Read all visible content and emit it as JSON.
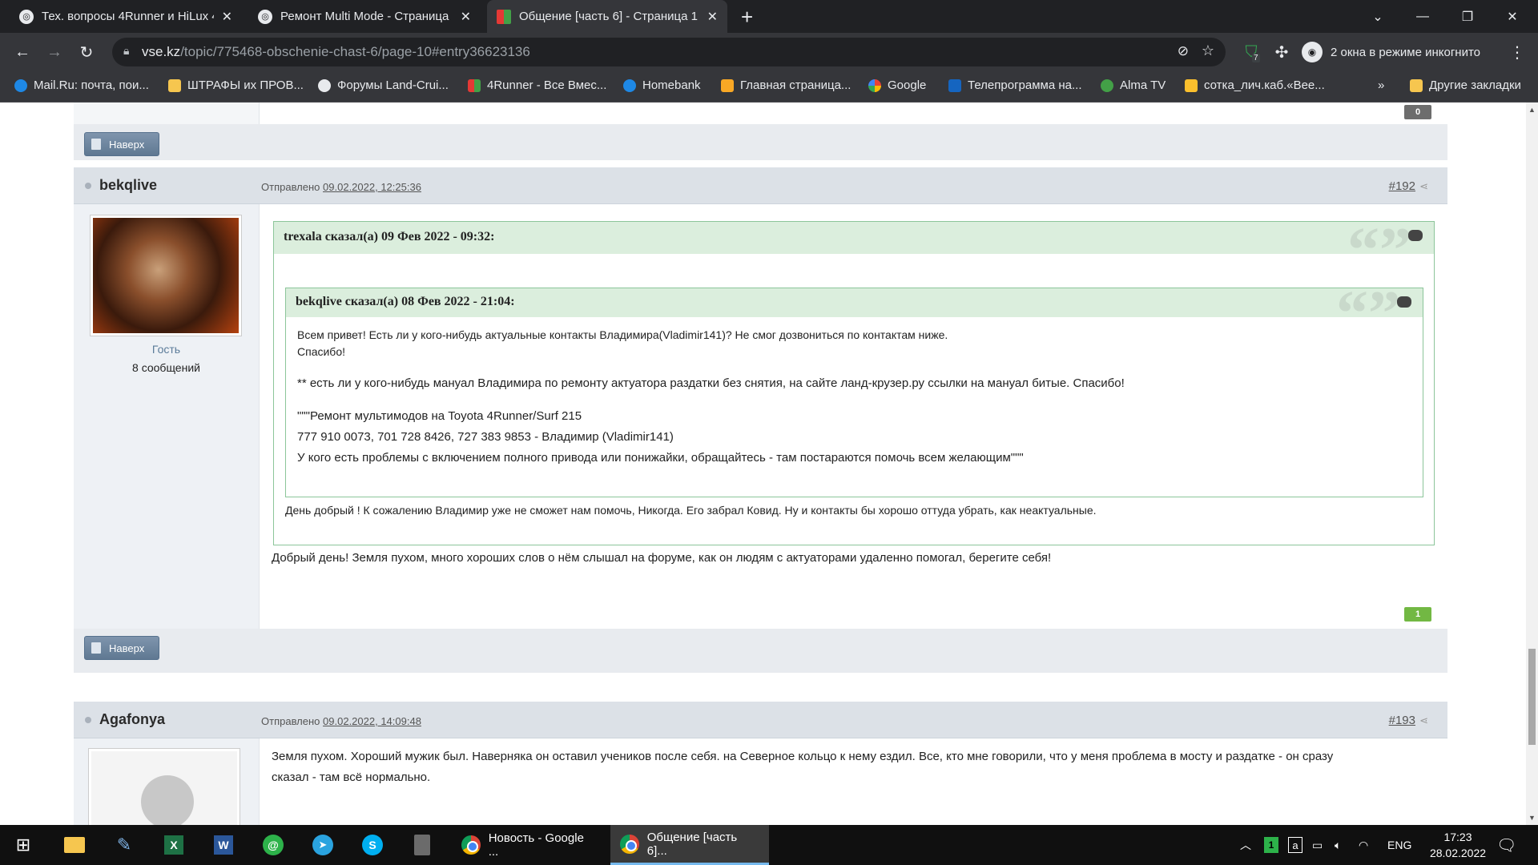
{
  "browser": {
    "tabs": [
      {
        "title": "Тех. вопросы 4Runner и HiLux 4",
        "active": false
      },
      {
        "title": "Ремонт Multi Mode - Страница",
        "active": false
      },
      {
        "title": "Общение [часть 6] - Страница 1",
        "active": true
      }
    ],
    "url_host": "vse.kz",
    "url_path": "/topic/775468-obschenie-chast-6/page-10#entry36623136",
    "incognito_label": "2 окна в режиме инкогнито",
    "extension_badge": "7",
    "bookmarks": [
      {
        "label": "Mail.Ru: почта, пои...",
        "color": "#1e88e5"
      },
      {
        "label": "ШТРАФЫ их ПРОВ...",
        "color": "#f6c64f"
      },
      {
        "label": "Форумы Land-Crui...",
        "color": "#e8eaed"
      },
      {
        "label": "4Runner - Все Вмес...",
        "color": "#e53935"
      },
      {
        "label": "Homebank",
        "color": "#1e88e5"
      },
      {
        "label": "Главная страница...",
        "color": "#f9a825"
      },
      {
        "label": "Google",
        "color": "#4285f4"
      },
      {
        "label": "Телепрограмма на...",
        "color": "#1565c0"
      },
      {
        "label": "Alma TV",
        "color": "#43a047"
      },
      {
        "label": "сотка_лич.каб.«Вее...",
        "color": "#fbc02d"
      }
    ],
    "bookmarks_more": "»",
    "other_bookmarks": "Другие закладки"
  },
  "forum": {
    "top_button": "Наверх",
    "prev_counter": "0",
    "posts": [
      {
        "author": "bekqlive",
        "sent_label": "Отправлено",
        "sent_date": "09.02.2022, 12:25:36",
        "number": "#192",
        "role": "Гость",
        "post_count": "8 сообщений",
        "outer_quote_head": "trexala сказал(а) 09 Фев 2022 - 09:32:",
        "inner_quote_head": "bekqlive сказал(а) 08 Фев 2022 - 21:04:",
        "inner_lines": [
          "Всем привет! Есть ли у кого-нибудь актуальные контакты Владимира(Vladimir141)? Не смог дозвониться по контактам ниже.",
          "Спасибо!",
          "** есть ли у кого-нибудь мануал Владимира по ремонту актуатора раздатки без снятия, на сайте ланд-крузер.ру ссылки на мануал битые. Спасибо!",
          "\"\"\"Ремонт мультимодов на Toyota 4Runner/Surf 215",
          "777 910 0073, 701 728 8426, 727 383 9853 - Владимир (Vladimir141)",
          "У кого есть проблемы с включением полного привода или понижайки, обращайтесь - там постараются помочь всем желающим\"\"\""
        ],
        "outer_reply": "День добрый ! К сожалению Владимир уже не сможет нам помочь, Никогда. Его забрал Ковид. Ну и контакты бы хорошо оттуда убрать, как неактуальные.",
        "message": "Добрый день! Земля пухом, много хороших слов о нём слышал на форуме, как он людям с актуаторами удаленно помогал, берегите себя!",
        "counter": "1"
      },
      {
        "author": "Agafonya",
        "sent_label": "Отправлено",
        "sent_date": "09.02.2022, 14:09:48",
        "number": "#193",
        "message_line1": "Земля пухом. Хороший мужик был. Наверняка он оставил учеников после себя. на Северное кольцо к нему ездил. Все, кто мне говорили, что у меня проблема в мосту и раздатке - он сразу",
        "message_line2": "сказал - там всё нормально."
      }
    ]
  },
  "taskbar": {
    "apps": [
      {
        "label": "Новость - Google ...",
        "active": false
      },
      {
        "label": "Общение [часть 6]...",
        "active": true
      }
    ],
    "lang": "ENG",
    "time": "17:23",
    "date": "28.02.2022"
  }
}
